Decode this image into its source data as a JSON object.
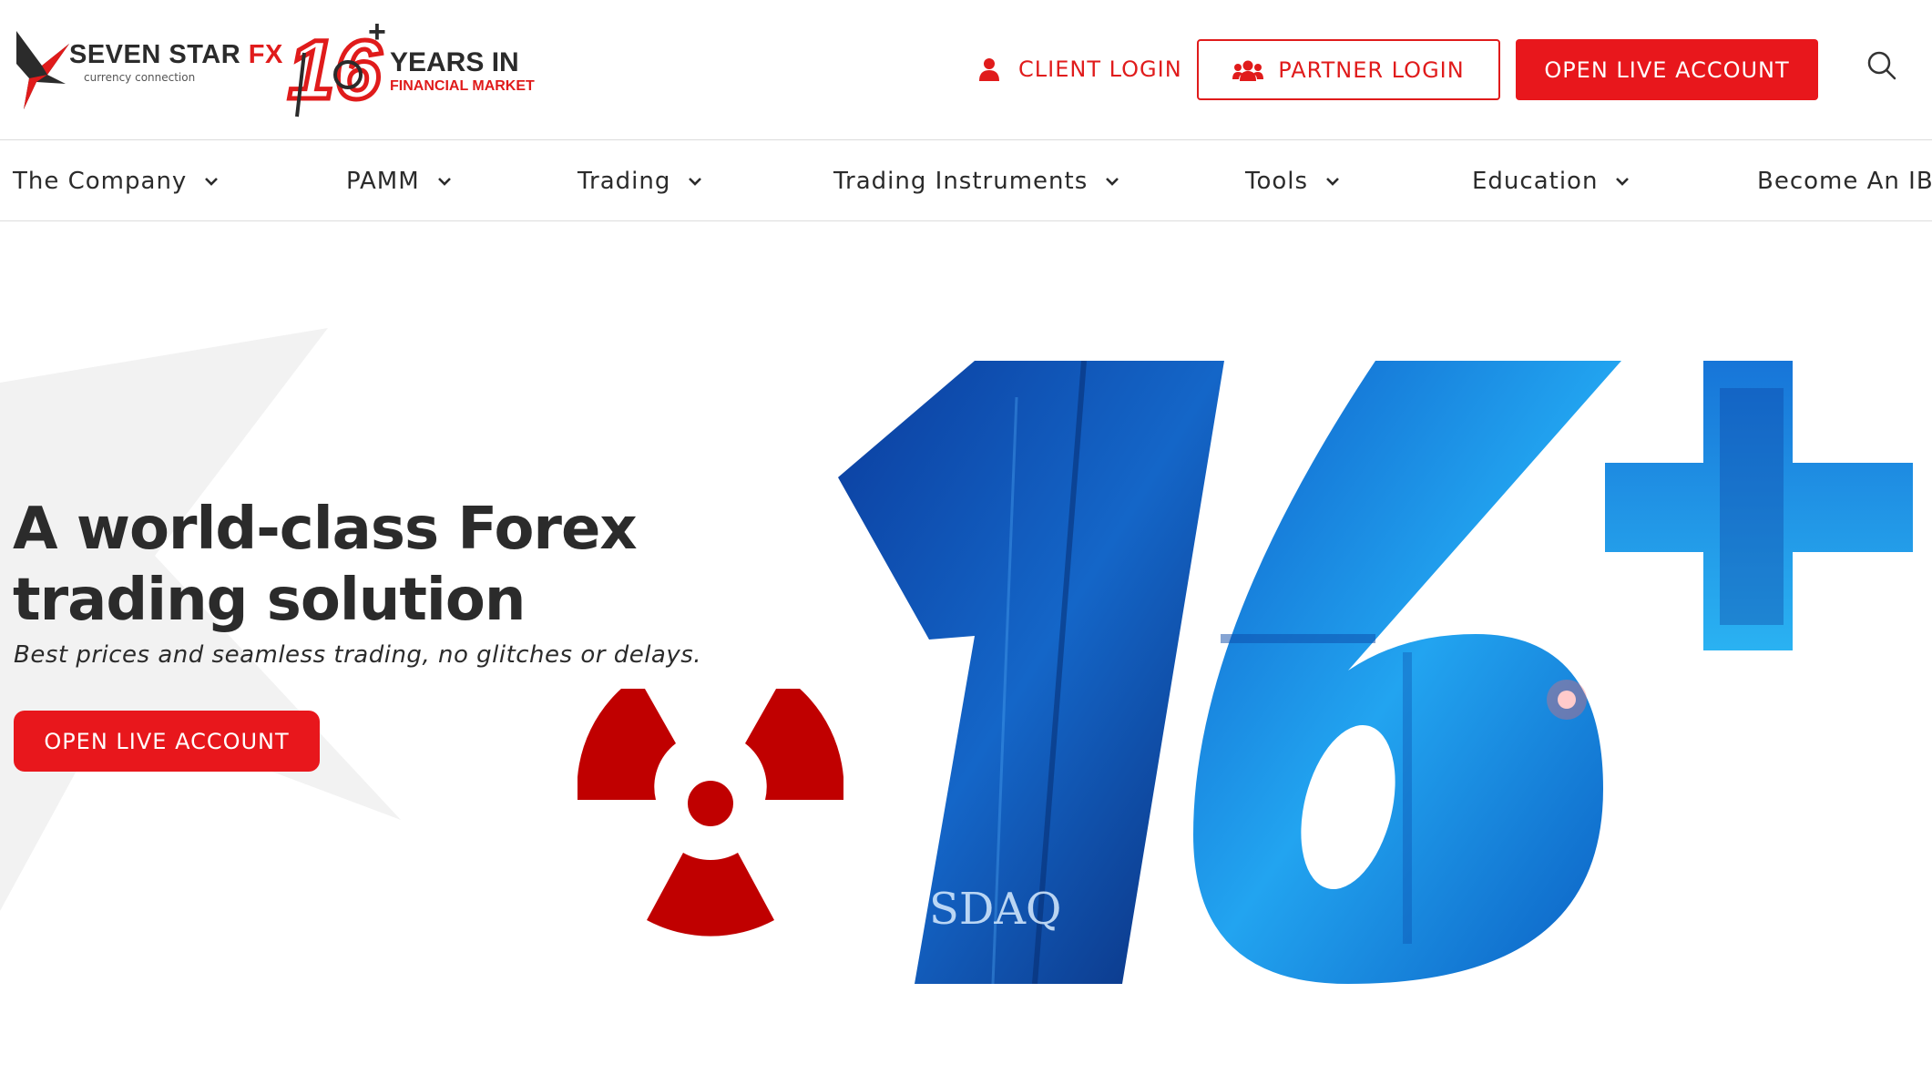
{
  "brand": {
    "name": "SEVEN STAR",
    "name_accent": "FX",
    "tagline": "currency connection",
    "badge_number": "16",
    "badge_plus": "+",
    "badge_title": "YEARS IN",
    "badge_subtitle": "FINANCIAL MARKET"
  },
  "header": {
    "client_login": "CLIENT LOGIN",
    "partner_login": "PARTNER LOGIN",
    "open_live_account": "OPEN LIVE ACCOUNT"
  },
  "nav": {
    "items": [
      {
        "label": "The Company"
      },
      {
        "label": "PAMM"
      },
      {
        "label": "Trading"
      },
      {
        "label": "Trading Instruments"
      },
      {
        "label": "Tools"
      },
      {
        "label": "Education"
      },
      {
        "label": "Become An IB"
      }
    ]
  },
  "hero": {
    "title_line1": "A world-class Forex",
    "title_line2": "trading solution",
    "subtitle": "Best prices and seamless trading, no glitches or delays.",
    "cta": "OPEN LIVE ACCOUNT",
    "graphic_text": "16+",
    "graphic_caption": "SDAQ"
  },
  "colors": {
    "brand_red": "#e8171c",
    "dark_text": "#2b2b2b",
    "hero_blue": "#1a8be0",
    "radiation_red": "#c00000"
  },
  "icons": [
    "user-icon",
    "users-icon",
    "search-icon",
    "chevron-down-icon",
    "radiation-icon"
  ]
}
